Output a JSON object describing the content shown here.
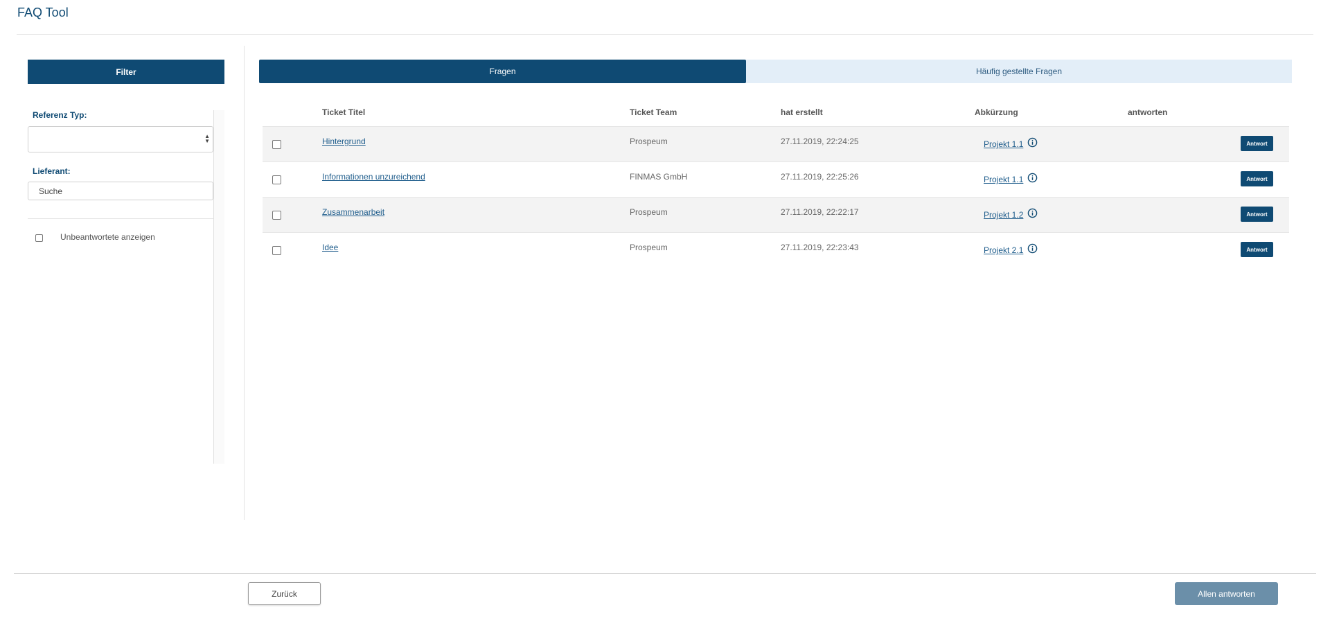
{
  "app": {
    "title": "FAQ Tool"
  },
  "sidebar": {
    "filter_header": "Filter",
    "reference_type_label": "Referenz Typ:",
    "reference_type_value": "",
    "supplier_label": "Lieferant:",
    "supplier_search_value": "Suche",
    "unanswered_label": "Unbeantwortete anzeigen"
  },
  "tabs": [
    {
      "label": "Fragen",
      "active": true
    },
    {
      "label": "Häufig gestellte Fragen",
      "active": false
    }
  ],
  "table": {
    "headers": {
      "title": "Ticket Titel",
      "team": "Ticket Team",
      "created": "hat erstellt",
      "abbreviation": "Abkürzung",
      "answers": "antworten"
    },
    "rows": [
      {
        "title": "Hintergrund",
        "team": "Prospeum",
        "created": "27.11.2019, 22:24:25",
        "abbreviation": "Projekt 1.1",
        "action": "Antwort"
      },
      {
        "title": "Informationen unzureichend",
        "team": "FINMAS GmbH",
        "created": "27.11.2019, 22:25:26",
        "abbreviation": "Projekt 1.1",
        "action": "Antwort"
      },
      {
        "title": "Zusammenarbeit",
        "team": "Prospeum",
        "created": "27.11.2019, 22:22:17",
        "abbreviation": "Projekt 1.2",
        "action": "Antwort"
      },
      {
        "title": "Idee",
        "team": "Prospeum",
        "created": "27.11.2019, 22:23:43",
        "abbreviation": "Projekt 2.1",
        "action": "Antwort"
      }
    ]
  },
  "footer": {
    "back_label": "Zurück",
    "answer_all_label": "Allen antworten"
  },
  "colors": {
    "primary": "#0f4a73",
    "tab_inactive_bg": "#e3eef8",
    "link": "#1f5d8c",
    "disabled_button": "#6b8fa9"
  },
  "icons": [
    "info-icon",
    "select-arrows-icon"
  ]
}
